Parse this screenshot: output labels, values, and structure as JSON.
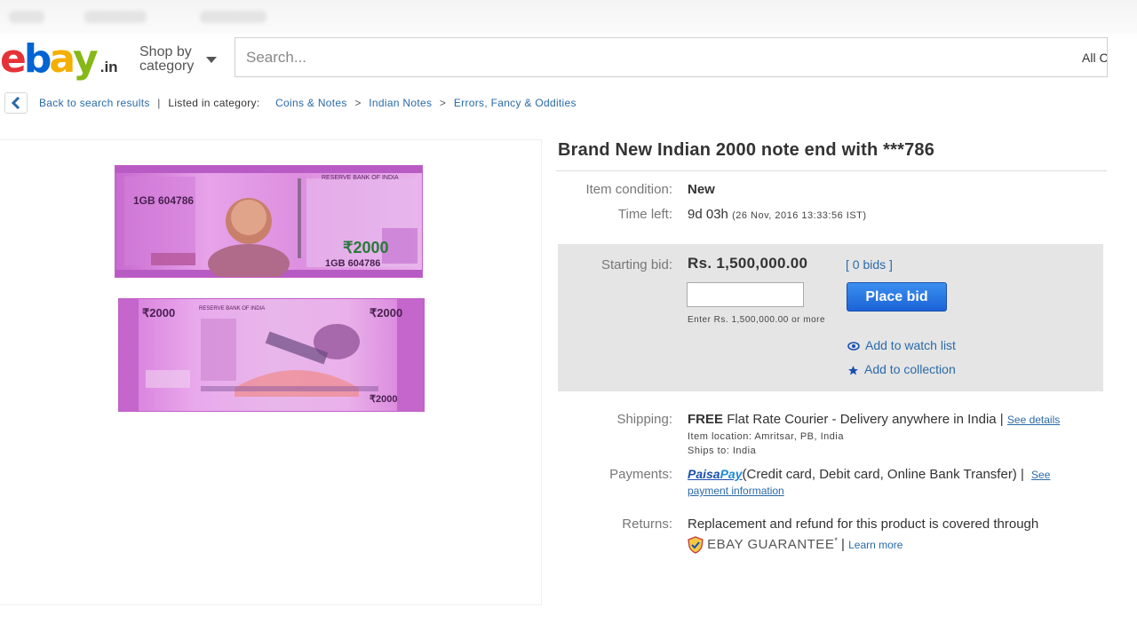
{
  "header": {
    "logo": {
      "e": "e",
      "b": "b",
      "a": "a",
      "y": "y",
      "tld": ".in"
    },
    "shop_by_line1": "Shop by",
    "shop_by_line2": "category",
    "search_placeholder": "Search...",
    "category_select": "All C"
  },
  "breadcrumb": {
    "back_label": "Back to search results",
    "listed_label": "Listed in category:",
    "items": [
      "Coins & Notes",
      "Indian Notes",
      "Errors, Fancy & Oddities"
    ]
  },
  "images": {
    "front": {
      "serial_top": "1GB 604786",
      "denomination": "₹2000",
      "serial_bottom": "1GB 604786",
      "bank": "RESERVE BANK OF INDIA"
    },
    "back": {
      "denomination_left": "₹2000",
      "denomination_right": "₹2000",
      "denomination_bottom": "₹2000",
      "bank": "RESERVE BANK OF INDIA"
    }
  },
  "item": {
    "title": "Brand New Indian 2000 note end with ***786",
    "condition_label": "Item condition:",
    "condition_value": "New",
    "time_left_label": "Time left:",
    "time_left_value": "9d 03h",
    "time_left_date": "(26 Nov, 2016  13:33:56 IST)"
  },
  "bid": {
    "starting_label": "Starting bid:",
    "starting_value": "Rs. 1,500,000.00",
    "bids_link": "[ 0 bids ]",
    "place_bid_label": "Place bid",
    "hint": "Enter Rs. 1,500,000.00 or more",
    "watch_link": "Add to watch list",
    "collection_link": "Add to collection"
  },
  "shipping": {
    "label": "Shipping:",
    "free": "FREE",
    "method": "Flat Rate Courier - Delivery anywhere in India |",
    "see_details": "See details",
    "location": "Item location:  Amritsar, PB, India",
    "ships_to": "Ships to:  India"
  },
  "payments": {
    "label": "Payments:",
    "paisa": "Paisa",
    "pay": "Pay",
    "methods": "(Credit card, Debit card, Online Bank Transfer)  |",
    "see": "See",
    "payment_info": "payment information"
  },
  "returns": {
    "label": "Returns:",
    "text": "Replacement and refund for this product is covered through",
    "guarantee": "EBAY GUARANTEE",
    "guarantee_mark": "*",
    "sep": "|",
    "learn_more": "Learn more"
  },
  "colors": {
    "ebay_red": "#e53238",
    "ebay_blue": "#0064d2",
    "ebay_yellow": "#f5af02",
    "ebay_green": "#86b817",
    "link": "#2a6aa8",
    "bid_button": "#1a63d6",
    "bid_panel": "#e5e5e5",
    "note_magenta": "#d86fd8"
  },
  "icons": [
    "chevron-left-icon",
    "caret-down-icon",
    "eye-icon",
    "star-icon",
    "shield-icon"
  ]
}
